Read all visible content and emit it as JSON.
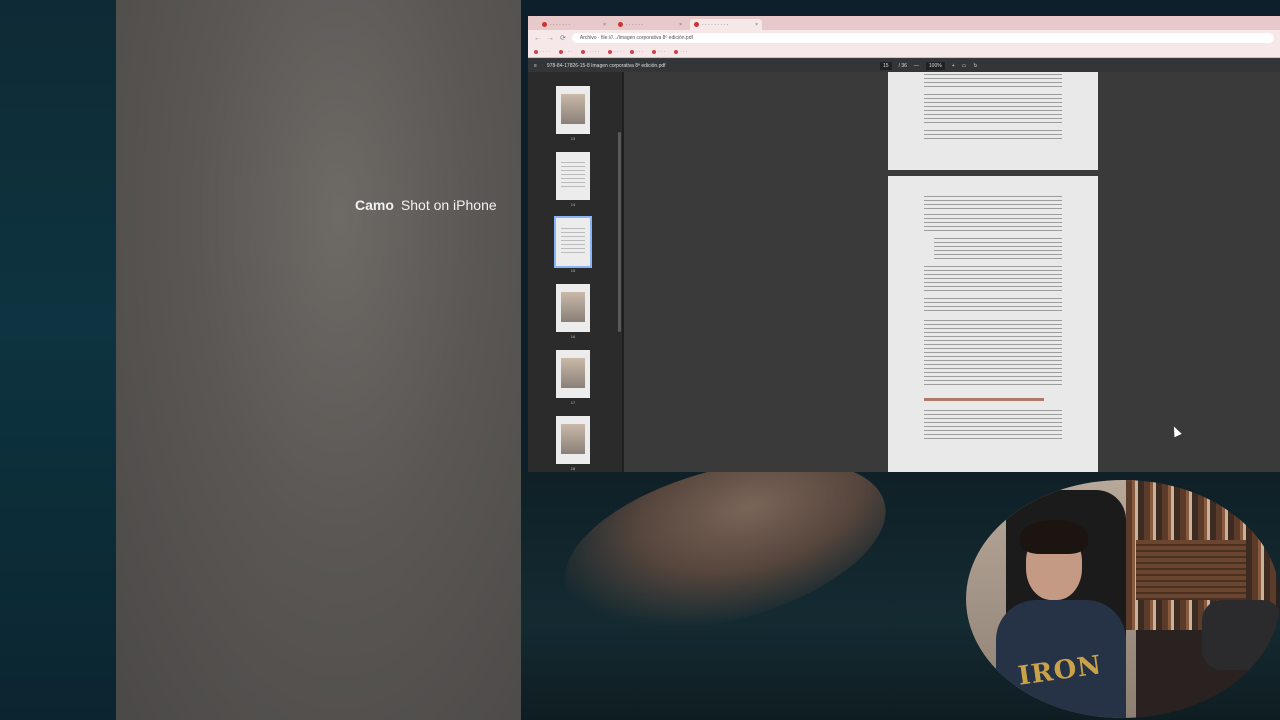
{
  "camera": {
    "brand": "Camo",
    "caption": "Shot on iPhone"
  },
  "browser": {
    "tabs": [
      {
        "label": "· · · · · · ·",
        "active": false
      },
      {
        "label": "· · · · · ·",
        "active": false
      },
      {
        "label": "· · · · · · · · ·",
        "active": true
      }
    ],
    "nav": {
      "back": "←",
      "forward": "→",
      "reload": "⟳"
    },
    "url": "Archivo · file:///.../Imagen corporativa 8º edición.pdf",
    "bookmarks": [
      "· · · ·",
      "· · ·",
      "· · · · ·",
      "· · ·",
      "· · ·",
      "· · ·",
      "· · ·"
    ]
  },
  "pdf": {
    "menu_icon": "≡",
    "filename": "978-84-17826-15-8 Imagen corporativa 8ª edición.pdf",
    "page": "15",
    "page_total": "/ 36",
    "zoom": "100%",
    "zoom_out": "—",
    "zoom_in": "+",
    "thumbnails": [
      {
        "num": "13",
        "kind": "image"
      },
      {
        "num": "14",
        "kind": "text"
      },
      {
        "num": "15",
        "kind": "text",
        "selected": true
      },
      {
        "num": "16",
        "kind": "image"
      },
      {
        "num": "17",
        "kind": "image"
      },
      {
        "num": "18",
        "kind": "image"
      }
    ]
  },
  "webcam": {
    "shirt_text": "IRON"
  }
}
